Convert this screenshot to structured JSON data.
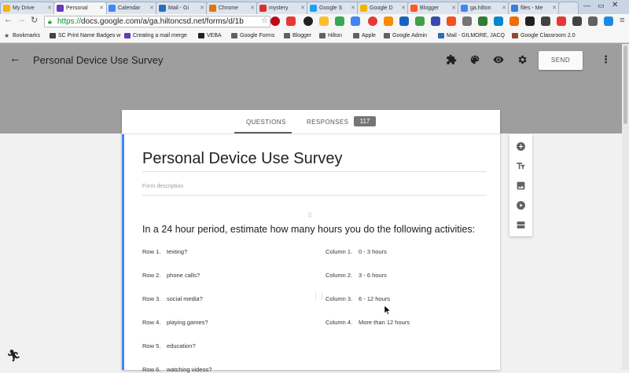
{
  "tabs": [
    {
      "label": "My Drive",
      "color": "#f4b400"
    },
    {
      "label": "Personal",
      "color": "#673ab7",
      "active": true
    },
    {
      "label": "Calendar",
      "color": "#4285f4"
    },
    {
      "label": "Mail - Gi",
      "color": "#2a6ebb"
    },
    {
      "label": "Chrome",
      "color": "#e8710a"
    },
    {
      "label": "mystery",
      "color": "#d93025"
    },
    {
      "label": "Google S",
      "color": "#1da1f2"
    },
    {
      "label": "Google D",
      "color": "#f4b400"
    },
    {
      "label": "Blogger",
      "color": "#ff5722"
    },
    {
      "label": "ga.hilton",
      "color": "#4285f4"
    },
    {
      "label": "files - Me",
      "color": "#3b7dd8"
    }
  ],
  "omnibox": {
    "https": "https://",
    "rest": "docs.google.com/a/ga.hiltoncsd.net/forms/d/1b"
  },
  "bookmarks": [
    {
      "label": "Bookmarks",
      "color": "#555"
    },
    {
      "label": "SC Print Name Badges w",
      "color": "#444"
    },
    {
      "label": "Creating a mail merge",
      "color": "#673ab7"
    },
    {
      "label": "VEBA",
      "color": "#222"
    },
    {
      "label": "Google Forms",
      "color": "#616161"
    },
    {
      "label": "Blogger",
      "color": "#616161"
    },
    {
      "label": "Hilton",
      "color": "#616161"
    },
    {
      "label": "Apple",
      "color": "#616161"
    },
    {
      "label": "Google Admin",
      "color": "#616161"
    },
    {
      "label": "Mail - GILMORE, JACQ",
      "color": "#2a6ebb"
    },
    {
      "label": "Google Classroom 2.0",
      "color": "#8d4c2f"
    }
  ],
  "header": {
    "title": "Personal Device Use Survey",
    "send_label": "SEND",
    "icons": [
      "puzzle-icon",
      "palette-icon",
      "eye-icon",
      "gear-icon",
      "more-vert-icon"
    ]
  },
  "form_tabs": {
    "questions": "QUESTIONS",
    "responses": "RESPONSES",
    "response_count": "117"
  },
  "form": {
    "title": "Personal Device Use Survey",
    "description_placeholder": "Form description",
    "question": "In a 24 hour period, estimate how many hours you do the following activities:",
    "rows": [
      {
        "num": "Row 1.",
        "label": "texting?"
      },
      {
        "num": "Row 2.",
        "label": "phone calls?"
      },
      {
        "num": "Row 3.",
        "label": "social media?"
      },
      {
        "num": "Row 4.",
        "label": "playing games?"
      },
      {
        "num": "Row 5.",
        "label": "education?"
      },
      {
        "num": "Row 6.",
        "label": "watching videos?"
      }
    ],
    "columns": [
      {
        "num": "Column 1.",
        "label": "0 - 3 hours"
      },
      {
        "num": "Column 2.",
        "label": "3 - 6 hours"
      },
      {
        "num": "Column 3.",
        "label": "6 - 12 hours"
      },
      {
        "num": "Column 4.",
        "label": "More than 12 hours"
      }
    ]
  },
  "sidebar_tools": [
    "add-question-icon",
    "title-text-icon",
    "image-icon",
    "video-icon",
    "section-icon"
  ],
  "colors": {
    "header_bg": "#9e9e9e",
    "accent_blue": "#4285f4",
    "badge": "#757575"
  }
}
